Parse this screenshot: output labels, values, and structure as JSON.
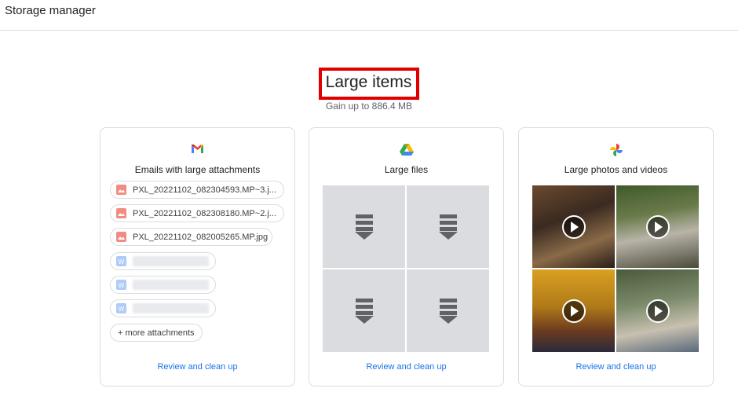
{
  "app": {
    "title": "Storage manager"
  },
  "header": {
    "title": "Large items",
    "subtitle": "Gain up to 886.4 MB"
  },
  "cards": [
    {
      "icon": "gmail-icon",
      "title": "Emails with large attachments",
      "attachments": [
        "PXL_20221102_082304593.MP~3.j...",
        "PXL_20221102_082308180.MP~2.j...",
        "PXL_20221102_082005265.MP.jpg"
      ],
      "more_label": "+ more attachments",
      "link": "Review and clean up"
    },
    {
      "icon": "google-drive-icon",
      "title": "Large files",
      "link": "Review and clean up"
    },
    {
      "icon": "google-photos-icon",
      "title": "Large photos and videos",
      "link": "Review and clean up"
    }
  ],
  "colors": {
    "link": "#1a73e8",
    "highlight": "#e00000",
    "placeholder_tile": "#dadce0"
  }
}
